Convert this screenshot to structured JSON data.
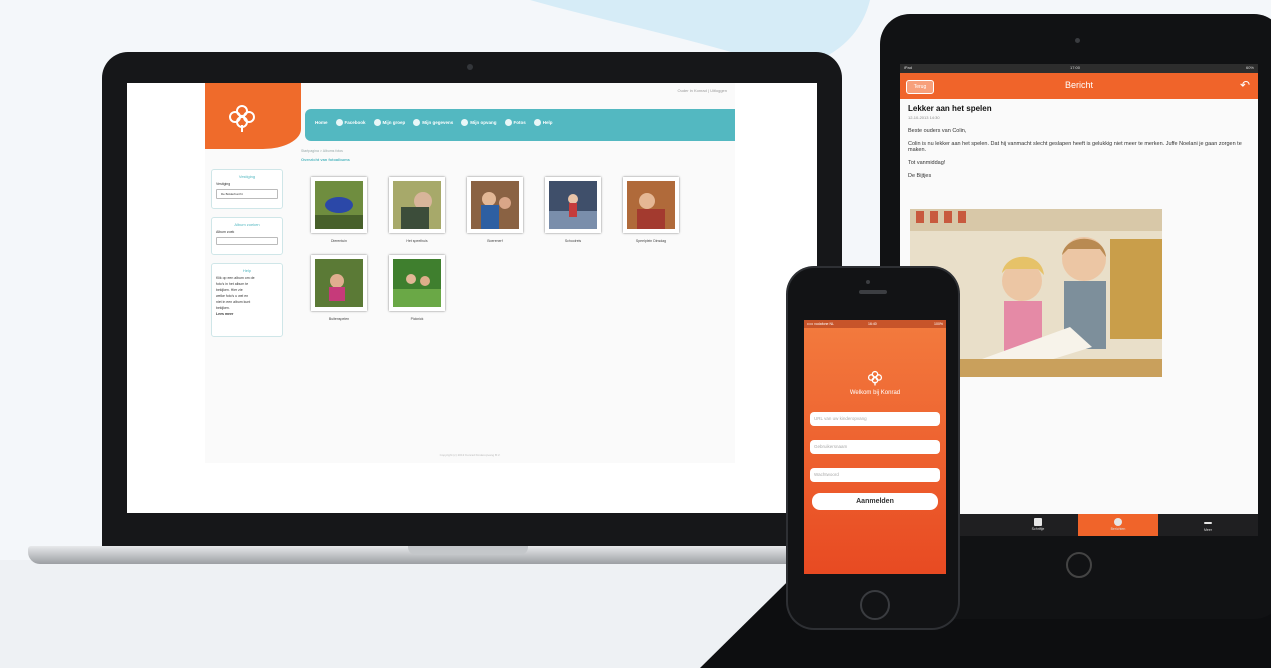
{
  "laptop": {
    "userlinks": "Ouder in Konrad  |  Uitloggen",
    "nav": [
      "Home",
      "Facebook",
      "Mijn groep",
      "Mijn gegevens",
      "Mijn opvang",
      "Fotos",
      "Help"
    ],
    "breadcrumb": "Startpagina  >  Albums fotos",
    "section_title": "Overzicht van fotoalbums",
    "sidebar": [
      {
        "title": "Vestiging",
        "lines": [
          "Vestiging",
          "De Bolderburcht"
        ]
      },
      {
        "title": "Album zoeken",
        "lines": [
          "Album zoek"
        ]
      },
      {
        "title": "Help",
        "lines": [
          "Klik op een album om de",
          "foto's in het album te",
          "bekijken. Hier zie",
          "welke foto's u wel en",
          "niet in een album kunt",
          "bekijken."
        ],
        "link": "Lees meer"
      }
    ],
    "albums": [
      "Dierentuin",
      "Het speelhuis",
      "Boerenerf",
      "Schoolreis",
      "Speelplein Dinsdag",
      "Buitenspelen",
      "Picknick"
    ],
    "copyright": "Copyright (c) 2013 Konrad Kinderopvang B.V."
  },
  "tablet": {
    "status_left": "iPad",
    "status_center": "17:00",
    "status_right": "60%",
    "back": "Terug",
    "title": "Bericht",
    "message_title": "Lekker aan het spelen",
    "message_date": "12-10-2013 14:30",
    "greeting": "Beste ouders van Colin,",
    "body": "Colin is nu lekker aan het spelen. Dat hij vanmacht slecht geslapen heeft is gelukkig niet meer te merken. Juffe Noelani je gaan zorgen te maken.",
    "closing": "Tot vanmiddag!",
    "signature": "De Bijtjes",
    "tabs": [
      "Schriftje",
      "Berichten",
      "Meer"
    ]
  },
  "phone": {
    "status_left": "••••• vodafone NL",
    "status_center": "16:40",
    "status_right": "100%",
    "welcome": "Welkom bij Konrad",
    "fields": [
      "URL van uw kinderopvang",
      "Gebruikersnaam",
      "Wachtwoord"
    ],
    "login": "Aanmelden"
  },
  "colors": {
    "brand_orange": "#ef6b2b",
    "teal": "#53b8c1"
  }
}
